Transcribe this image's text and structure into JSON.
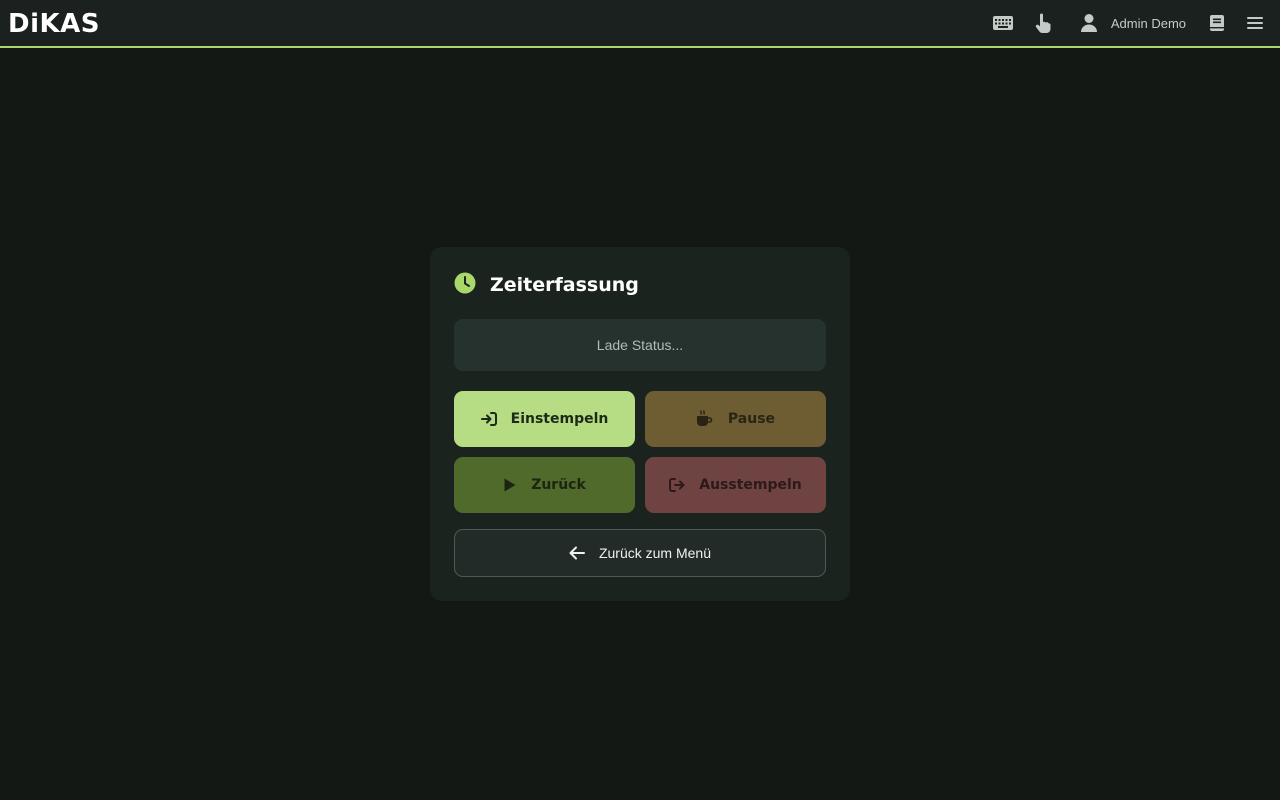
{
  "app": {
    "logo_text": "DiKAS"
  },
  "topbar": {
    "icons": [
      "keyboard-icon",
      "touch-icon",
      "user-icon",
      "book-icon",
      "menu-icon"
    ],
    "user_name": "Admin Demo"
  },
  "card": {
    "title": "Zeiterfassung",
    "title_icon": "clock-icon",
    "status_text": "Lade Status...",
    "buttons": {
      "clock_in": {
        "label": "Einstempeln",
        "icon": "sign-in-icon",
        "color": "#b6dd84"
      },
      "pause": {
        "label": "Pause",
        "icon": "coffee-icon",
        "color": "#6e5c33"
      },
      "resume": {
        "label": "Zurück",
        "icon": "play-icon",
        "color": "#4f6a2b"
      },
      "clock_out": {
        "label": "Ausstempeln",
        "icon": "sign-out-icon",
        "color": "#6e4342"
      }
    },
    "back_to_menu": {
      "label": "Zurück zum Menü",
      "icon": "arrow-left-icon"
    }
  },
  "colors": {
    "accent": "#a9d86a",
    "background": "#131815",
    "card": "#1b231f"
  }
}
